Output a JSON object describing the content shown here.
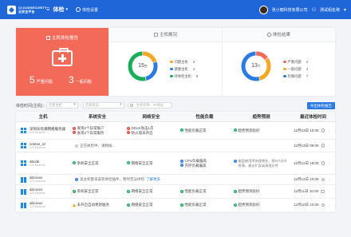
{
  "topbar": {
    "logo_text": "CLOUDSECURITY 云安全平台",
    "menu_icon": "grid-icon",
    "current_section": "体检",
    "settings_label": "体检设置",
    "user_name": "张小丽科技有限公司",
    "group_name": "测试组名称",
    "colors": {
      "bar": "#1f66d8"
    }
  },
  "summary": {
    "active_card": {
      "title": "主机体检报告",
      "severe_count": "5",
      "severe_label": "严重问题",
      "minor_count": "3",
      "minor_label": "一般问题",
      "color": "#f46a58"
    },
    "host_overview": {
      "title": "主机概况",
      "total": "15",
      "unit": "台",
      "legend": [
        {
          "label": "问题主机",
          "value": "3",
          "color": "#f5a623"
        },
        {
          "label": "健康主机",
          "value": "4",
          "color": "#2c7be5"
        },
        {
          "label": "待体检主机",
          "value": "8",
          "color": "#1aad5a"
        }
      ]
    },
    "check_results": {
      "title": "体检结果",
      "total": "13",
      "unit": "个",
      "legend": [
        {
          "label": "严重问题",
          "value": "2",
          "color": "#f46a58"
        },
        {
          "label": "一般问题",
          "value": "4",
          "color": "#f5a623"
        },
        {
          "label": "轻微问题",
          "value": "7",
          "color": "#2c7be5"
        }
      ]
    }
  },
  "filters": {
    "label": "体检时间(主机):",
    "host_select": "全部主机",
    "status_select": "全部状态",
    "search_placeholder": "主机名称、IP地址",
    "export_button": "导出体检报告"
  },
  "table": {
    "headers": [
      "主机",
      "系统安全",
      "网络安全",
      "性能负载",
      "趋势预测",
      "最近体检时间"
    ],
    "rows": [
      {
        "host": "深圳乐有驿网络服务器",
        "ip": "172.16.xx.xx",
        "sys": [
          {
            "type": "err",
            "text": "发现2个异常账户"
          },
          {
            "type": "err",
            "text": "发现2个异常服务"
          }
        ],
        "net": [
          {
            "type": "err",
            "text": "DDoS攻击1次"
          },
          {
            "type": "err",
            "text": "防火墙未开启"
          }
        ],
        "perf": [
          {
            "type": "ok",
            "text": "性能负载正常"
          }
        ],
        "trend": [
          {
            "type": "ok",
            "text": "趋势预测良好"
          }
        ],
        "time": "12月13日 10:00"
      },
      {
        "host": "centos_sz",
        "ip": "172.16.xx.xx",
        "message": "正在体检中，请稍候...",
        "message_type": "grey",
        "time": "12月13日 09:00"
      },
      {
        "host": "abcde",
        "ip": "172.16.xx.xx",
        "sys": [
          {
            "type": "ok",
            "text": "系统安全正常"
          }
        ],
        "net": [
          {
            "type": "ok",
            "text": "网络安全正常"
          }
        ],
        "perf": [
          {
            "type": "info",
            "text": "CPU负载偏高"
          },
          {
            "type": "info",
            "text": "内存负载偏高"
          }
        ],
        "trend": [
          {
            "type": "info",
            "text": "磁盘使用率快速增长，预计7天内将满，建议扩容或清理文件"
          }
        ],
        "time": "12月12日 18:00"
      },
      {
        "host": "abcxxxx",
        "ip": "172.16.xx.xx",
        "message": "该主机暂未安装体检插件，暂时无法体检",
        "message_link": "了解更多",
        "message_type": "info",
        "time": "12月12日 10:00"
      },
      {
        "host": "abcxxxx",
        "ip": "172.16.xx.xx",
        "sys": [
          {
            "type": "ok",
            "text": "系统安全正常"
          }
        ],
        "net": [
          {
            "type": "ok",
            "text": "网络安全正常"
          }
        ],
        "perf": [
          {
            "type": "ok",
            "text": "性能负载正常"
          }
        ],
        "trend": [
          {
            "type": "ok",
            "text": "趋势预测良好"
          }
        ],
        "time": "12月11日 10:00"
      },
      {
        "host": "abcxxxx",
        "ip": "172.16.xx.xx",
        "sys": [
          {
            "type": "warn",
            "text": "未开启自动更新服务"
          }
        ],
        "net": [
          {
            "type": "ok",
            "text": "网络安全正常"
          }
        ],
        "perf": [
          {
            "type": "ok",
            "text": "性能负载正常"
          }
        ],
        "trend": [
          {
            "type": "ok",
            "text": "趋势预测良好"
          }
        ],
        "time": "12月10日 10:00"
      }
    ]
  }
}
